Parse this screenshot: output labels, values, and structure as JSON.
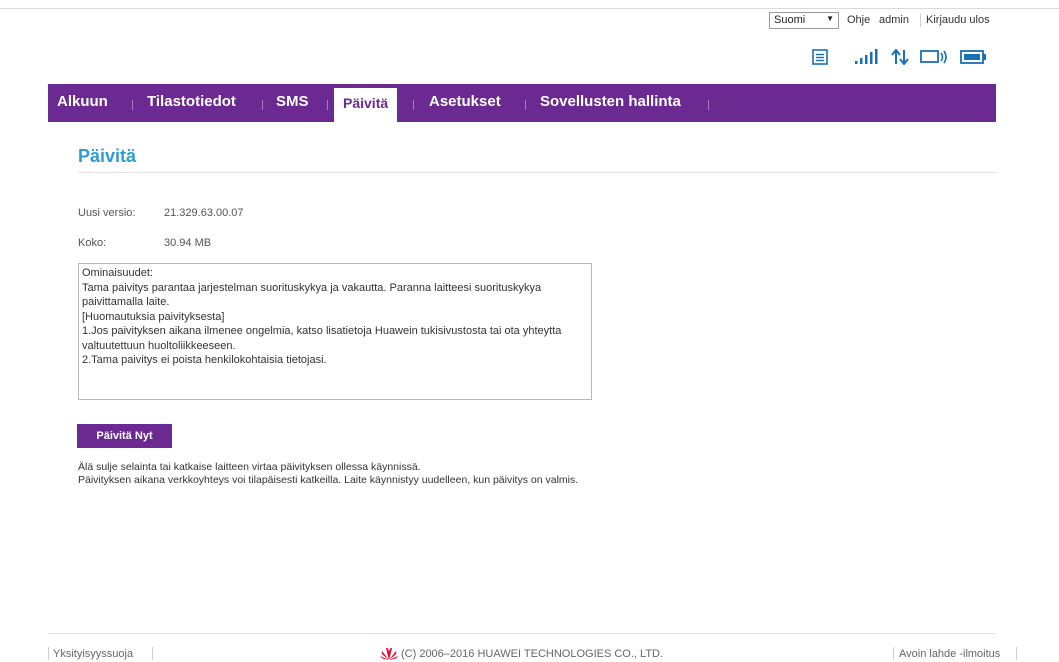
{
  "header": {
    "language": {
      "selected": "Suomi"
    },
    "links": {
      "help": "Ohje",
      "user": "admin",
      "logout": "Kirjaudu ulos"
    },
    "status_icons": [
      "sms-icon",
      "signal-strength-icon",
      "data-transfer-icon",
      "connection-icon",
      "battery-icon"
    ],
    "icon_color": "#1a6fb5"
  },
  "nav": {
    "tabs": [
      {
        "label": "Alkuun"
      },
      {
        "label": "Tilastotiedot"
      },
      {
        "label": "SMS"
      },
      {
        "label": "Päivitä",
        "active": true
      },
      {
        "label": "Asetukset"
      },
      {
        "label": "Sovellusten hallinta"
      }
    ],
    "color": "#6a2a91"
  },
  "main": {
    "title": "Päivitä",
    "new_version": {
      "label": "Uusi versio:",
      "value": "21.329.63.00.07"
    },
    "size": {
      "label": "Koko:",
      "value": "30.94 MB"
    },
    "notes": [
      "Ominaisuudet:",
      "Tama paivitys parantaa jarjestelman suorituskykya ja vakautta. Paranna laitteesi suorituskykya paivittamalla laite.",
      "[Huomautuksia paivityksesta]",
      "1.Jos paivityksen aikana ilmenee ongelmia, katso lisatietoja Huawein tukisivustosta tai ota yhteytta valtuutettuun huoltoliikkeeseen.",
      "2.Tama paivitys ei poista henkilokohtaisia tietojasi."
    ],
    "update_button": "Päivitä Nyt",
    "warning_1": "Älä sulje selainta tai katkaise laitteen virtaa päivityksen ollessa käynnissä.",
    "warning_2": "Päivityksen aikana verkkoyhteys voi tilapäisesti katkeilla. Laite käynnistyy uudelleen, kun päivitys on valmis."
  },
  "footer": {
    "privacy": "Yksityisyyssuoja",
    "copyright": "(C) 2006–2016 HUAWEI TECHNOLOGIES CO., LTD.",
    "open_source": "Avoin lahde -ilmoitus",
    "logo_color": "#e4002b"
  }
}
